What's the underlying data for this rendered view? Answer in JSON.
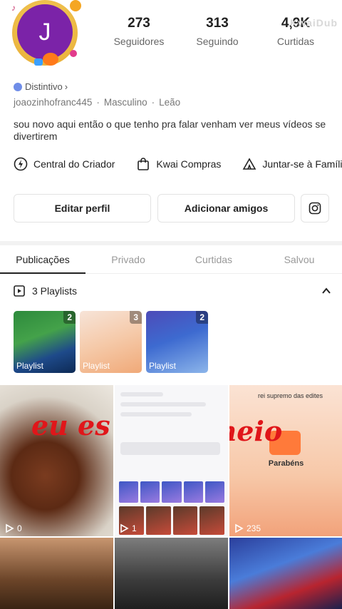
{
  "profile": {
    "avatar_initial": "J",
    "stats": [
      {
        "value": "273",
        "label": "Seguidores"
      },
      {
        "value": "313",
        "label": "Seguindo"
      },
      {
        "value": "4,9K",
        "label": "Curtidas"
      }
    ],
    "watermark": "KwaiDub",
    "badge_label": "Distintivo",
    "username": "joaozinhofranc445",
    "gender": "Masculino",
    "sign": "Leão",
    "bio": "sou novo aqui então o que tenho pra falar venham ver meus vídeos se divertirem"
  },
  "shortcuts": [
    {
      "label": "Central do Criador",
      "icon": "lightning-icon"
    },
    {
      "label": "Kwai Compras",
      "icon": "shopping-bag-icon"
    },
    {
      "label": "Juntar-se à Família",
      "icon": "family-tent-icon"
    }
  ],
  "buttons": {
    "edit": "Editar perfil",
    "add_friends": "Adicionar amigos"
  },
  "tabs": [
    "Publicações",
    "Privado",
    "Curtidas",
    "Salvou"
  ],
  "playlists": {
    "title": "3 Playlists",
    "items": [
      {
        "count": "2",
        "label": "Playlist"
      },
      {
        "count": "3",
        "label": "Playlist"
      },
      {
        "count": "2",
        "label": "Playlist"
      }
    ]
  },
  "posts": [
    {
      "overlay": "eu es",
      "views": "0"
    },
    {
      "overlay": "",
      "views": "1"
    },
    {
      "overlay": "meio",
      "views": "235",
      "mini_title": "rei supremo das edites",
      "mini_caption": "Parabéns"
    },
    {
      "overlay": "",
      "views": ""
    },
    {
      "overlay": "",
      "views": ""
    },
    {
      "overlay": "",
      "views": ""
    }
  ]
}
